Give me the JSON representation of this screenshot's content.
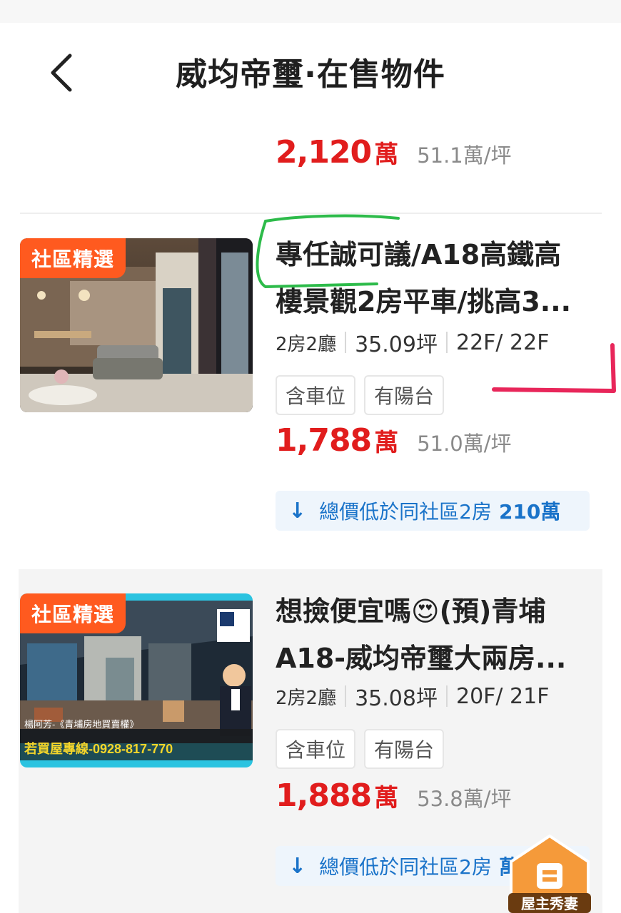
{
  "header": {
    "back_icon": "chevron-left-icon",
    "title": "威均帝璽·在售物件"
  },
  "partial_listing": {
    "price": "2,120",
    "price_unit": "萬",
    "unit_price": "51.1萬/坪"
  },
  "listings": [
    {
      "badge": "社區精選",
      "title_line1": "專任誠可議/A18高鐵高",
      "title_line2": "樓景觀2房平車/挑高3...",
      "rooms": "2房2廳",
      "size": "35.09坪",
      "floor": "22F/ 22F",
      "tags": [
        "含車位",
        "有陽台"
      ],
      "price": "1,788",
      "price_unit": "萬",
      "unit_price": "51.0萬/坪",
      "compare_text": "總價低於同社區2房",
      "compare_amount": "210萬"
    },
    {
      "badge": "社區精選",
      "title_line1": "想撿便宜嗎😍(預)青埔",
      "title_line2": "A18-威均帝璽大兩房...",
      "rooms": "2房2廳",
      "size": "35.08坪",
      "floor": "20F/ 21F",
      "tags": [
        "含車位",
        "有陽台"
      ],
      "price": "1,888",
      "price_unit": "萬",
      "unit_price": "53.8萬/坪",
      "compare_text": "總價低於同社區2房",
      "compare_amount": "萬",
      "thumb_banner_text": "若買屋專線-0928-817-770",
      "thumb_caption": "楊阿芳-《青埔房地買賣權》"
    }
  ],
  "floating_badge": {
    "icon": "house-mascot-icon",
    "label": "屋主秀妻"
  },
  "colors": {
    "price_red": "#e11d1d",
    "badge_orange": "#ff5a1f",
    "compare_blue": "#1a73c9",
    "annotation_green": "#2dbb4a",
    "annotation_pink": "#e8265a"
  }
}
